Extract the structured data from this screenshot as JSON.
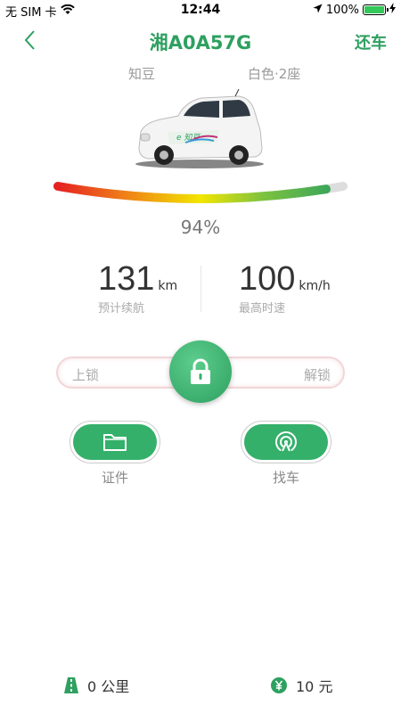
{
  "status_bar": {
    "carrier": "无 SIM 卡",
    "time": "12:44",
    "battery": "100%"
  },
  "nav": {
    "title": "湘A0A57G",
    "return_label": "还车"
  },
  "car": {
    "model": "知豆",
    "color_seats": "白色·2座"
  },
  "charge": {
    "percent_label": "94%",
    "level": 0.94
  },
  "stats": {
    "range": {
      "value": "131",
      "unit": "km",
      "label": "预计续航"
    },
    "top_speed": {
      "value": "100",
      "unit": "km/h",
      "label": "最高时速"
    }
  },
  "lock_slider": {
    "lock_label": "上锁",
    "unlock_label": "解锁"
  },
  "actions": {
    "documents_label": "证件",
    "find_car_label": "找车"
  },
  "footer": {
    "distance": "0 公里",
    "cost": "10 元"
  },
  "colors": {
    "brand_green": "#2ea060",
    "gauge_red": "#e52222",
    "gauge_yellow": "#f2e600",
    "gauge_green": "#2ea060"
  },
  "icons": [
    "chevron-left-icon",
    "lock-icon",
    "folder-icon",
    "signal-icon",
    "road-icon",
    "yuan-icon",
    "wifi-icon",
    "location-arrow-icon",
    "charging-bolt-icon"
  ]
}
